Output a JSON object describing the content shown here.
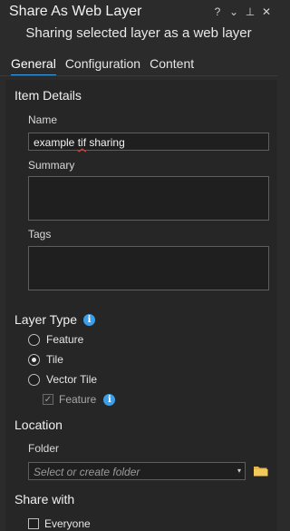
{
  "header": {
    "title": "Share As Web Layer",
    "subtitle": "Sharing selected layer as a web layer",
    "icons": [
      "help-icon",
      "chevron-down-icon",
      "pin-icon",
      "close-icon"
    ],
    "help_glyph": "?",
    "chevron_glyph": "⌄",
    "pin_glyph": "⊥",
    "close_glyph": "✕"
  },
  "tabs": [
    {
      "label": "General",
      "active": true
    },
    {
      "label": "Configuration",
      "active": false
    },
    {
      "label": "Content",
      "active": false
    }
  ],
  "item_details": {
    "heading": "Item Details",
    "name_label": "Name",
    "name_value_part1": "example ",
    "name_value_misspelled": "tif",
    "name_value_part2": " sharing",
    "summary_label": "Summary",
    "summary_value": "",
    "tags_label": "Tags",
    "tags_value": ""
  },
  "layer_type": {
    "heading": "Layer Type",
    "options": [
      {
        "label": "Feature",
        "selected": false
      },
      {
        "label": "Tile",
        "selected": true
      },
      {
        "label": "Vector Tile",
        "selected": false
      }
    ],
    "sub_option": {
      "label": "Feature",
      "checked": true,
      "disabled": true
    },
    "info_glyph": "i"
  },
  "location": {
    "heading": "Location",
    "folder_label": "Folder",
    "folder_placeholder": "Select or create folder",
    "caret_glyph": "▾"
  },
  "share_with": {
    "heading": "Share with",
    "everyone_label": "Everyone",
    "everyone_checked": false
  },
  "colors": {
    "accent": "#3d9ee8",
    "background": "#2b2b2b",
    "folder_icon": "#e8b64a"
  }
}
